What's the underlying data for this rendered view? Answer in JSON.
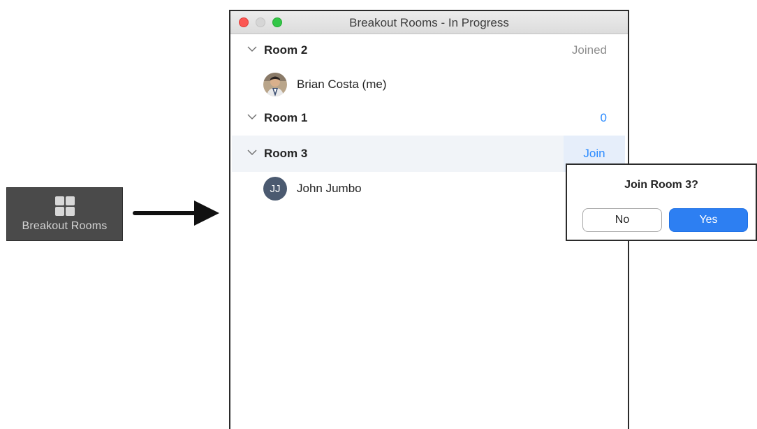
{
  "toolbar_button": {
    "label": "Breakout Rooms",
    "icon": "grid-icon"
  },
  "window": {
    "title": "Breakout Rooms - In Progress",
    "rooms": [
      {
        "name": "Room 2",
        "status": "Joined",
        "participants": [
          {
            "name": "Brian Costa (me)",
            "avatar": "photo"
          }
        ]
      },
      {
        "name": "Room 1",
        "count": "0",
        "participants": []
      },
      {
        "name": "Room 3",
        "action": "Join",
        "participants": [
          {
            "name": "John Jumbo",
            "initials": "JJ"
          }
        ]
      }
    ]
  },
  "join_dialog": {
    "question": "Join Room 3?",
    "no_label": "No",
    "yes_label": "Yes"
  },
  "colors": {
    "accent": "#2d8cff",
    "yes_button": "#2d7ff2",
    "toolbar_bg": "#4a4a4a",
    "avatar_bg": "#4b5a70"
  }
}
